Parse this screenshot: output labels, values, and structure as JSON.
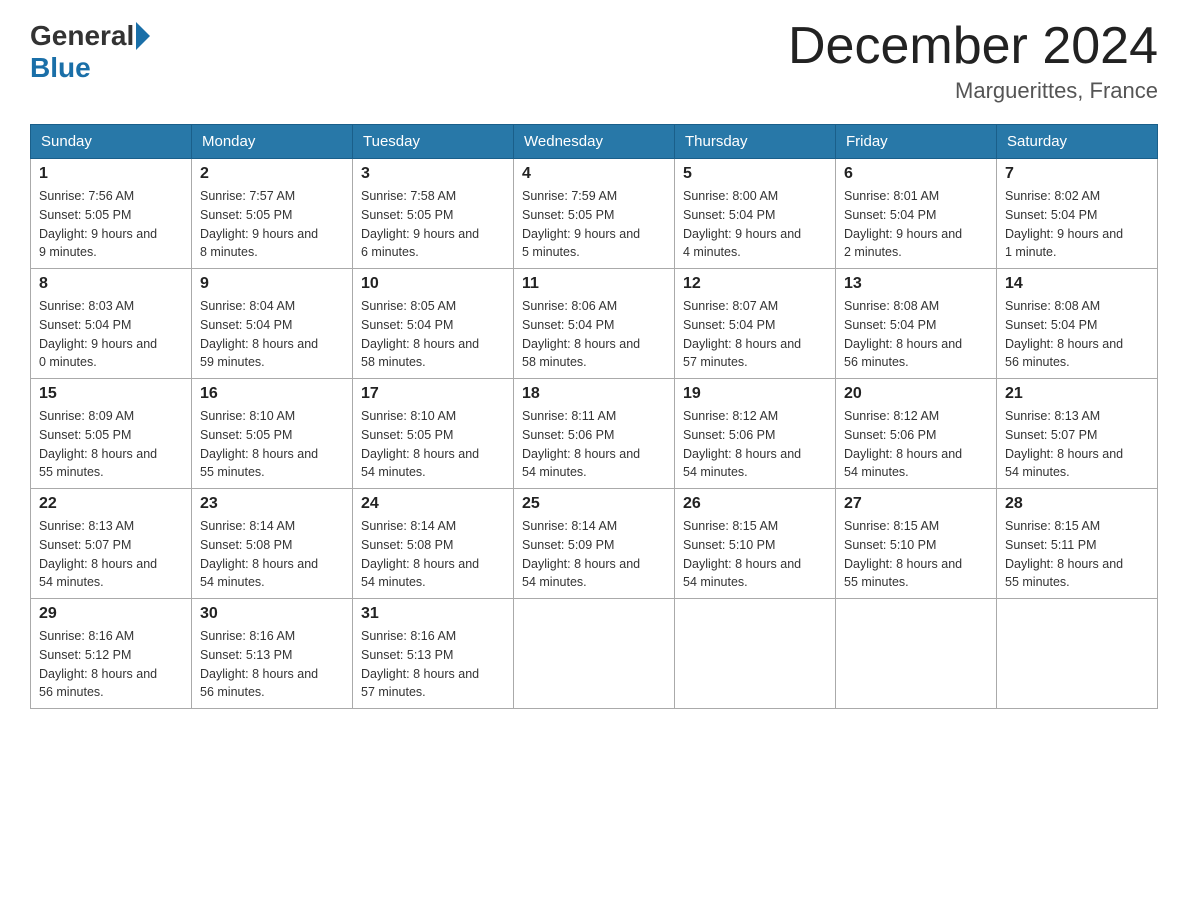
{
  "header": {
    "title": "December 2024",
    "location": "Marguerittes, France",
    "logo_general": "General",
    "logo_blue": "Blue"
  },
  "days_of_week": [
    "Sunday",
    "Monday",
    "Tuesday",
    "Wednesday",
    "Thursday",
    "Friday",
    "Saturday"
  ],
  "weeks": [
    [
      {
        "day": "1",
        "sunrise": "7:56 AM",
        "sunset": "5:05 PM",
        "daylight": "9 hours and 9 minutes."
      },
      {
        "day": "2",
        "sunrise": "7:57 AM",
        "sunset": "5:05 PM",
        "daylight": "9 hours and 8 minutes."
      },
      {
        "day": "3",
        "sunrise": "7:58 AM",
        "sunset": "5:05 PM",
        "daylight": "9 hours and 6 minutes."
      },
      {
        "day": "4",
        "sunrise": "7:59 AM",
        "sunset": "5:05 PM",
        "daylight": "9 hours and 5 minutes."
      },
      {
        "day": "5",
        "sunrise": "8:00 AM",
        "sunset": "5:04 PM",
        "daylight": "9 hours and 4 minutes."
      },
      {
        "day": "6",
        "sunrise": "8:01 AM",
        "sunset": "5:04 PM",
        "daylight": "9 hours and 2 minutes."
      },
      {
        "day": "7",
        "sunrise": "8:02 AM",
        "sunset": "5:04 PM",
        "daylight": "9 hours and 1 minute."
      }
    ],
    [
      {
        "day": "8",
        "sunrise": "8:03 AM",
        "sunset": "5:04 PM",
        "daylight": "9 hours and 0 minutes."
      },
      {
        "day": "9",
        "sunrise": "8:04 AM",
        "sunset": "5:04 PM",
        "daylight": "8 hours and 59 minutes."
      },
      {
        "day": "10",
        "sunrise": "8:05 AM",
        "sunset": "5:04 PM",
        "daylight": "8 hours and 58 minutes."
      },
      {
        "day": "11",
        "sunrise": "8:06 AM",
        "sunset": "5:04 PM",
        "daylight": "8 hours and 58 minutes."
      },
      {
        "day": "12",
        "sunrise": "8:07 AM",
        "sunset": "5:04 PM",
        "daylight": "8 hours and 57 minutes."
      },
      {
        "day": "13",
        "sunrise": "8:08 AM",
        "sunset": "5:04 PM",
        "daylight": "8 hours and 56 minutes."
      },
      {
        "day": "14",
        "sunrise": "8:08 AM",
        "sunset": "5:04 PM",
        "daylight": "8 hours and 56 minutes."
      }
    ],
    [
      {
        "day": "15",
        "sunrise": "8:09 AM",
        "sunset": "5:05 PM",
        "daylight": "8 hours and 55 minutes."
      },
      {
        "day": "16",
        "sunrise": "8:10 AM",
        "sunset": "5:05 PM",
        "daylight": "8 hours and 55 minutes."
      },
      {
        "day": "17",
        "sunrise": "8:10 AM",
        "sunset": "5:05 PM",
        "daylight": "8 hours and 54 minutes."
      },
      {
        "day": "18",
        "sunrise": "8:11 AM",
        "sunset": "5:06 PM",
        "daylight": "8 hours and 54 minutes."
      },
      {
        "day": "19",
        "sunrise": "8:12 AM",
        "sunset": "5:06 PM",
        "daylight": "8 hours and 54 minutes."
      },
      {
        "day": "20",
        "sunrise": "8:12 AM",
        "sunset": "5:06 PM",
        "daylight": "8 hours and 54 minutes."
      },
      {
        "day": "21",
        "sunrise": "8:13 AM",
        "sunset": "5:07 PM",
        "daylight": "8 hours and 54 minutes."
      }
    ],
    [
      {
        "day": "22",
        "sunrise": "8:13 AM",
        "sunset": "5:07 PM",
        "daylight": "8 hours and 54 minutes."
      },
      {
        "day": "23",
        "sunrise": "8:14 AM",
        "sunset": "5:08 PM",
        "daylight": "8 hours and 54 minutes."
      },
      {
        "day": "24",
        "sunrise": "8:14 AM",
        "sunset": "5:08 PM",
        "daylight": "8 hours and 54 minutes."
      },
      {
        "day": "25",
        "sunrise": "8:14 AM",
        "sunset": "5:09 PM",
        "daylight": "8 hours and 54 minutes."
      },
      {
        "day": "26",
        "sunrise": "8:15 AM",
        "sunset": "5:10 PM",
        "daylight": "8 hours and 54 minutes."
      },
      {
        "day": "27",
        "sunrise": "8:15 AM",
        "sunset": "5:10 PM",
        "daylight": "8 hours and 55 minutes."
      },
      {
        "day": "28",
        "sunrise": "8:15 AM",
        "sunset": "5:11 PM",
        "daylight": "8 hours and 55 minutes."
      }
    ],
    [
      {
        "day": "29",
        "sunrise": "8:16 AM",
        "sunset": "5:12 PM",
        "daylight": "8 hours and 56 minutes."
      },
      {
        "day": "30",
        "sunrise": "8:16 AM",
        "sunset": "5:13 PM",
        "daylight": "8 hours and 56 minutes."
      },
      {
        "day": "31",
        "sunrise": "8:16 AM",
        "sunset": "5:13 PM",
        "daylight": "8 hours and 57 minutes."
      },
      null,
      null,
      null,
      null
    ]
  ],
  "labels": {
    "sunrise": "Sunrise:",
    "sunset": "Sunset:",
    "daylight": "Daylight:"
  }
}
